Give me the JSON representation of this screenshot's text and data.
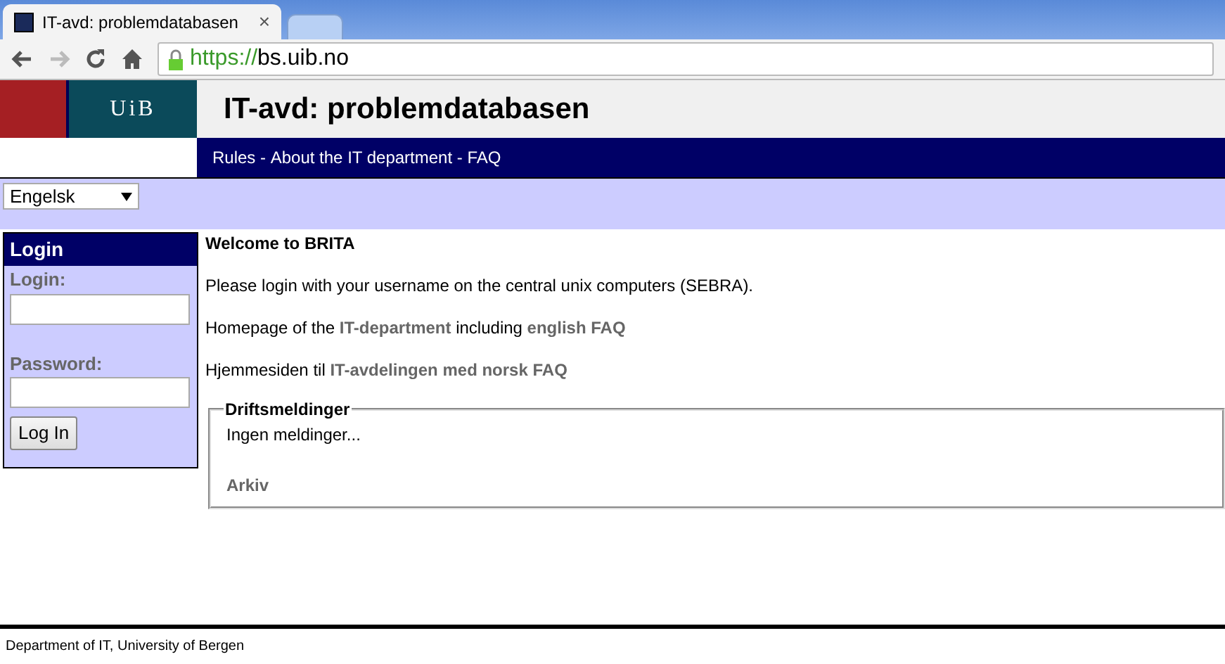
{
  "browser": {
    "tabs": [
      {
        "title": "IT-avd: problemdatabasen",
        "selected": true,
        "close": "×"
      },
      {
        "selected": false
      }
    ],
    "url_scheme": "https://",
    "url_host": "bs.uib.no"
  },
  "header": {
    "logo": "UiB",
    "title": "IT-avd: problemdatabasen"
  },
  "nav": [
    {
      "label": "Rules",
      "sep": " - "
    },
    {
      "label": "About the IT department",
      "sep": " - "
    },
    {
      "label": "FAQ"
    }
  ],
  "language": {
    "value": "Engelsk"
  },
  "login": {
    "title": "Login",
    "fields": [
      {
        "label": "Login:"
      },
      {
        "label": "Password:"
      }
    ],
    "button": "Log In"
  },
  "content": {
    "heading": "Welcome to BRITA",
    "paragraphs": [
      [
        {
          "kind": "text",
          "text": "Please login with your username on the central unix computers (SEBRA)."
        }
      ],
      [
        {
          "kind": "text",
          "text": "Homepage of the "
        },
        {
          "kind": "link",
          "text": "IT-department"
        },
        {
          "kind": "text",
          "text": " including "
        },
        {
          "kind": "link",
          "text": "english FAQ"
        }
      ],
      [
        {
          "kind": "text",
          "text": "Hjemmesiden til "
        },
        {
          "kind": "link",
          "text": "IT-avdelingen med norsk FAQ"
        }
      ]
    ],
    "notices": {
      "legend": "Driftsmeldinger",
      "message": "Ingen meldinger...",
      "archive": "Arkiv"
    }
  },
  "footer": "Department of IT, University of Bergen"
}
